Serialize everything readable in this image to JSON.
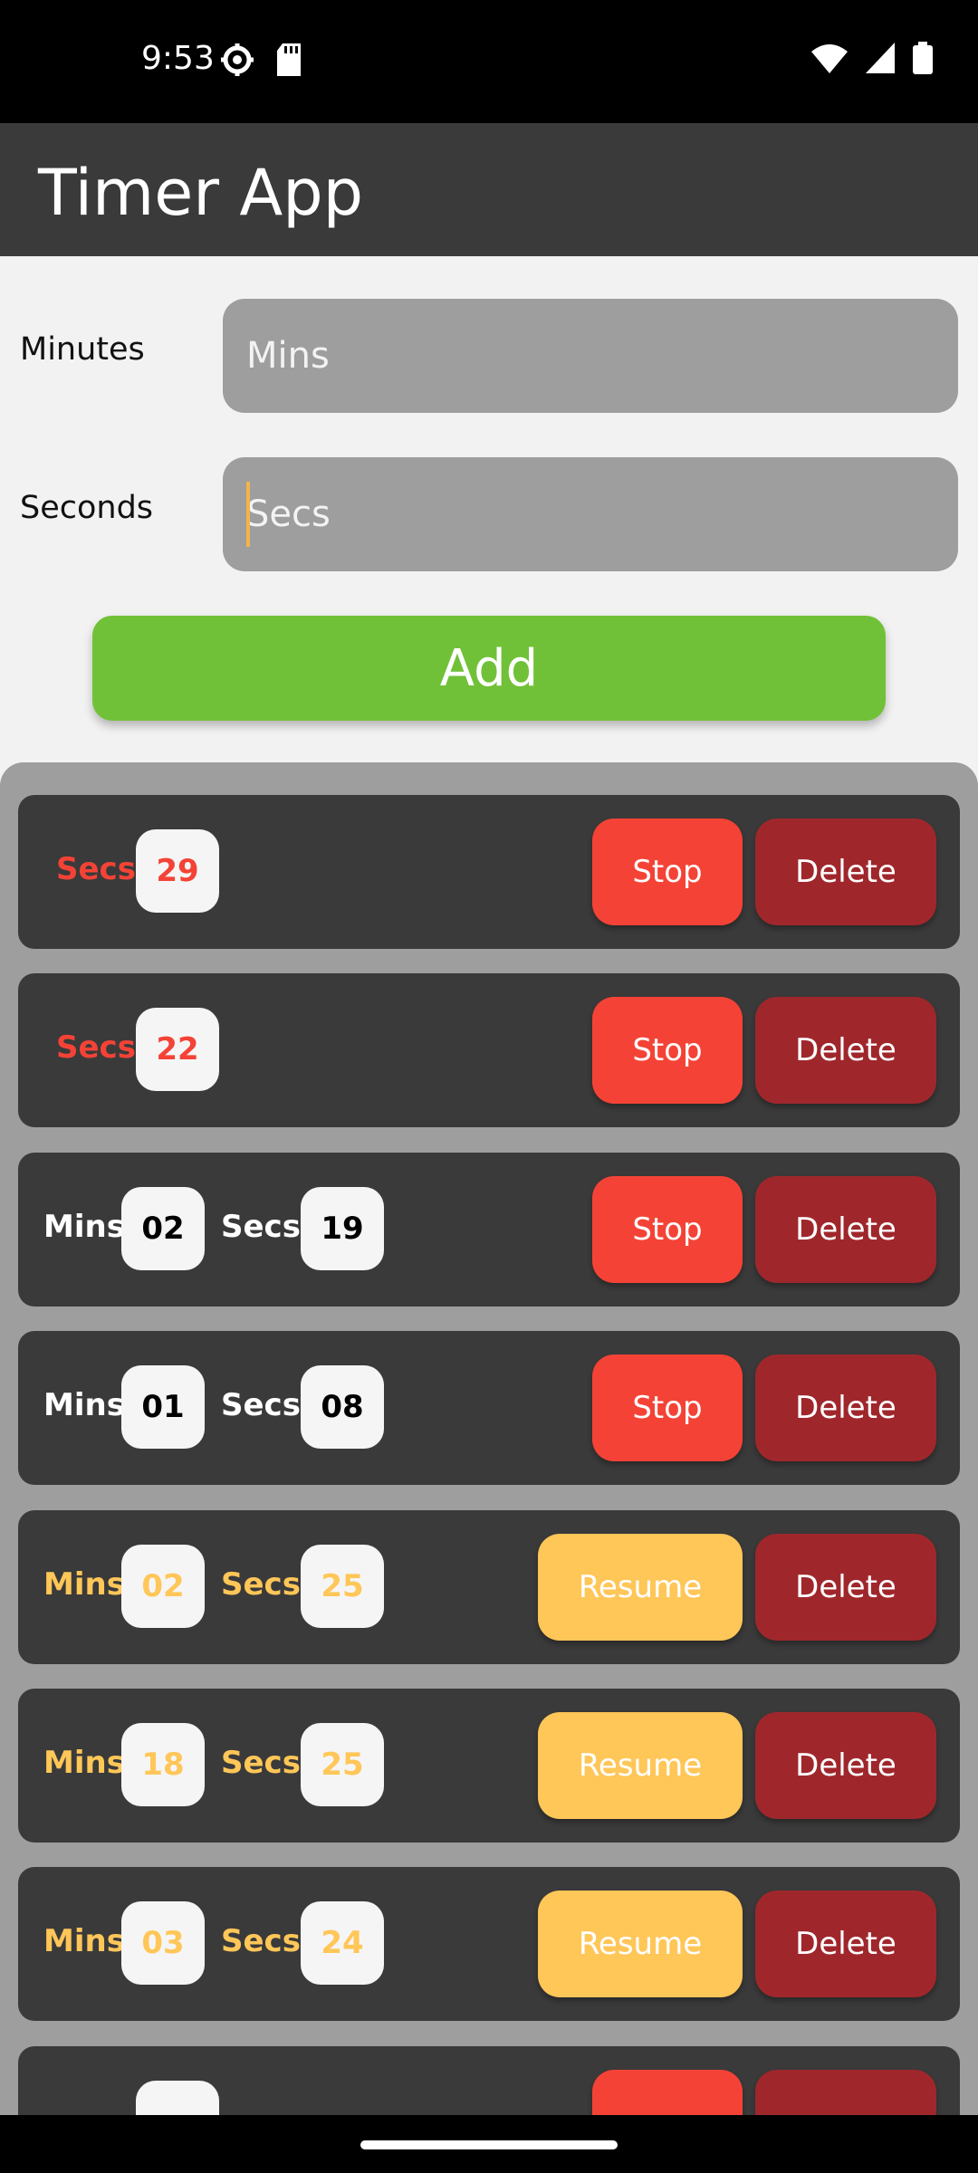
{
  "status": {
    "time": "9:53",
    "icons_left": [
      "settings-icon",
      "sd-card-icon"
    ],
    "icons_right": [
      "wifi-icon",
      "signal-icon",
      "battery-icon"
    ]
  },
  "app": {
    "title": "Timer App"
  },
  "form": {
    "minutes_label": "Minutes",
    "minutes_placeholder": "Mins",
    "seconds_label": "Seconds",
    "seconds_placeholder": "Secs",
    "add_label": "Add"
  },
  "timers": [
    {
      "mins_label": "",
      "mins": "",
      "secs_label": "Secs",
      "secs": "29",
      "action": "Stop",
      "delete": "Delete",
      "state": "running"
    },
    {
      "mins_label": "",
      "mins": "",
      "secs_label": "Secs",
      "secs": "22",
      "action": "Stop",
      "delete": "Delete",
      "state": "running"
    },
    {
      "mins_label": "Mins",
      "mins": "02",
      "secs_label": "Secs",
      "secs": "19",
      "action": "Stop",
      "delete": "Delete",
      "state": "running"
    },
    {
      "mins_label": "Mins",
      "mins": "01",
      "secs_label": "Secs",
      "secs": "08",
      "action": "Stop",
      "delete": "Delete",
      "state": "running"
    },
    {
      "mins_label": "Mins",
      "mins": "02",
      "secs_label": "Secs",
      "secs": "25",
      "action": "Resume",
      "delete": "Delete",
      "state": "paused"
    },
    {
      "mins_label": "Mins",
      "mins": "18",
      "secs_label": "Secs",
      "secs": "25",
      "action": "Resume",
      "delete": "Delete",
      "state": "paused"
    },
    {
      "mins_label": "Mins",
      "mins": "03",
      "secs_label": "Secs",
      "secs": "24",
      "action": "Resume",
      "delete": "Delete",
      "state": "paused"
    }
  ],
  "colors": {
    "app_bar": "#3a3a3a",
    "add_button": "#71c138",
    "stop_button": "#f44336",
    "resume_button": "#ffc658",
    "delete_button": "#9f272c",
    "panel": "#9e9e9e"
  }
}
